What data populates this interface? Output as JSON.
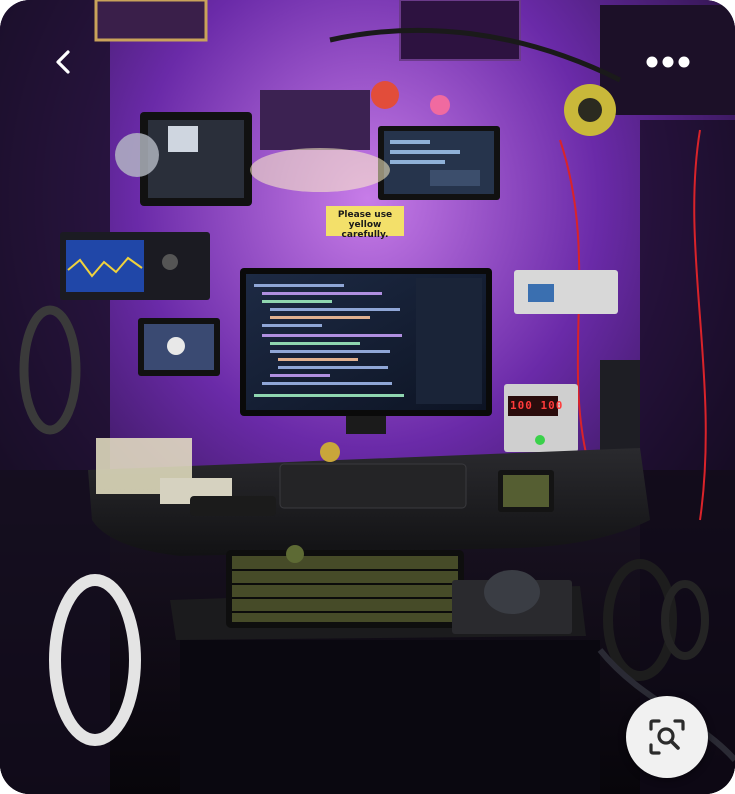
{
  "viewer": {
    "back_icon": "chevron-left-icon",
    "more_icon": "more-dots-icon",
    "lens_icon": "visual-search-icon"
  },
  "photo": {
    "wall_sign": "Please use yellow carefully.",
    "power_supply_readout": "100 100"
  },
  "colors": {
    "ambient_light": "#7a2fd0",
    "lens_button_bg": "#f1f1f1"
  }
}
